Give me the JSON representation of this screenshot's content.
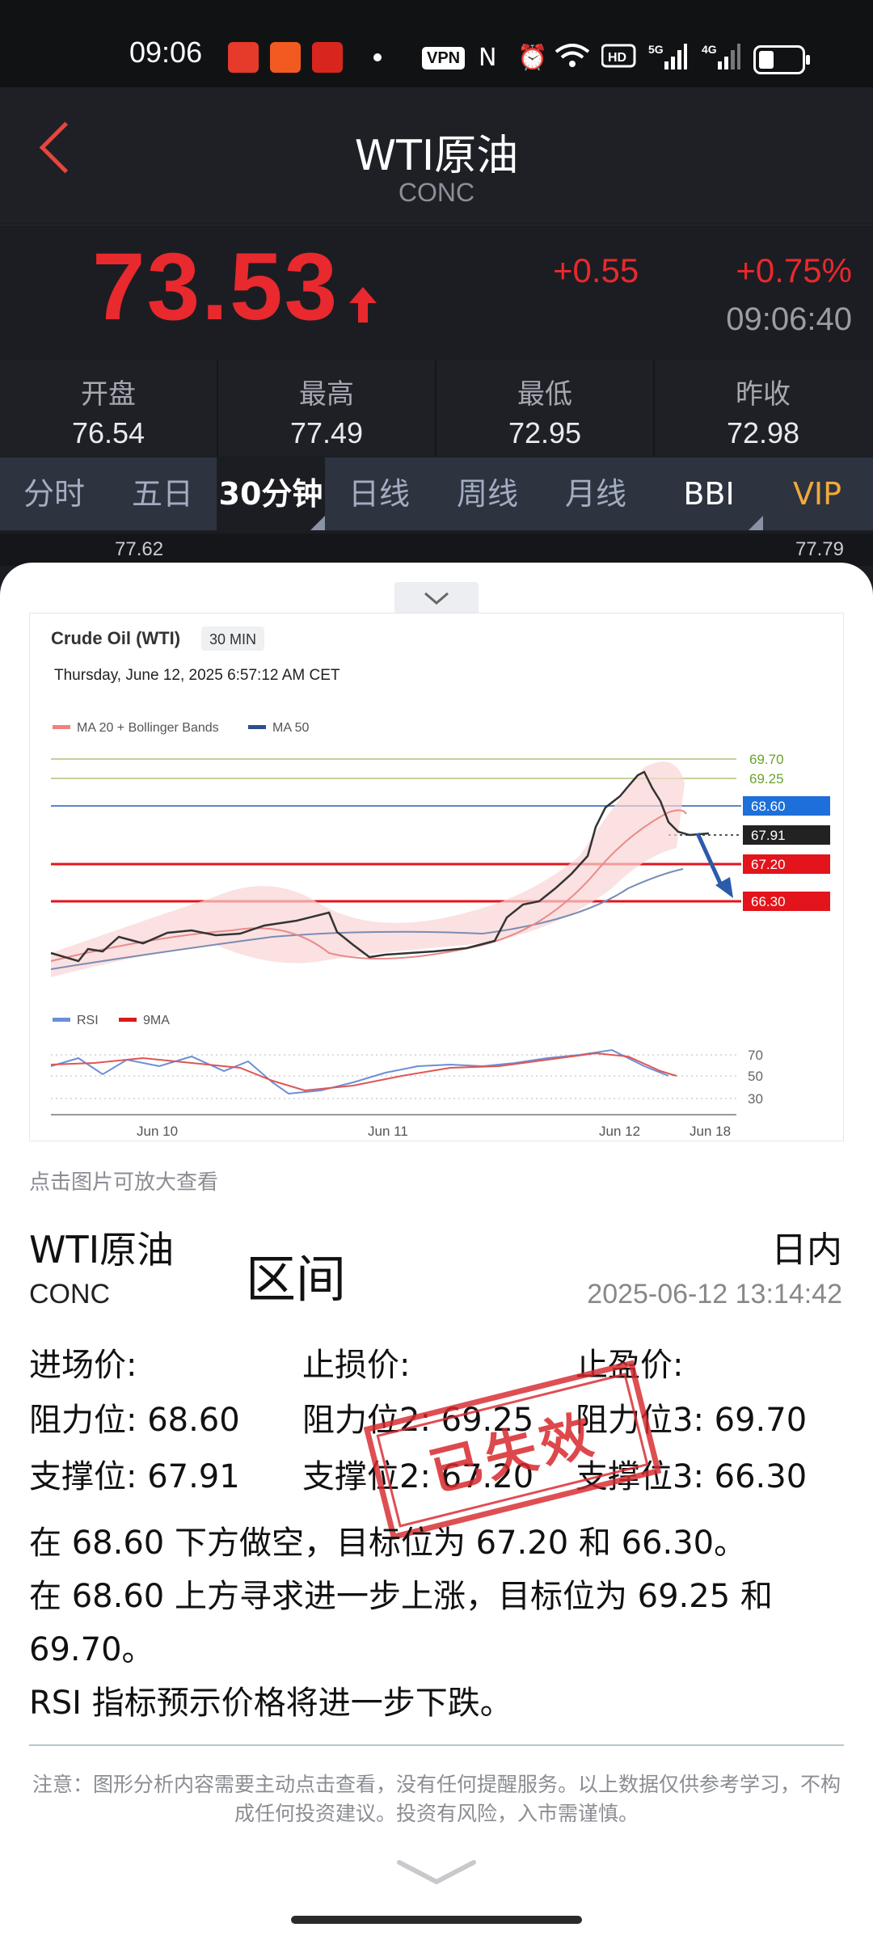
{
  "status_bar": {
    "time": "09:06",
    "vpn": "VPN"
  },
  "header": {
    "title": "WTI原油",
    "subtitle": "CONC"
  },
  "quote": {
    "price": "73.53",
    "change": "+0.55",
    "change_pct": "+0.75%",
    "time": "09:06:40"
  },
  "stats": [
    {
      "label": "开盘",
      "value": "76.54"
    },
    {
      "label": "最高",
      "value": "77.49"
    },
    {
      "label": "最低",
      "value": "72.95"
    },
    {
      "label": "昨收",
      "value": "72.98"
    }
  ],
  "tabs": [
    {
      "label": "分时"
    },
    {
      "label": "五日"
    },
    {
      "label": "30分钟"
    },
    {
      "label": "日线"
    },
    {
      "label": "周线"
    },
    {
      "label": "月线"
    },
    {
      "label": "BBI"
    },
    {
      "label": "VIP"
    }
  ],
  "peek": {
    "left_value": "77.62",
    "right_value": "77.79"
  },
  "chart_image": {
    "title": "Crude Oil (WTI)",
    "interval": "30 MIN",
    "timestamp": "Thursday, June 12, 2025 6:57:12 AM CET",
    "legend": [
      "MA 20 + Bollinger Bands",
      "MA 50"
    ],
    "levels": [
      "69.70",
      "69.25",
      "68.60",
      "67.91",
      "67.20",
      "66.30"
    ],
    "rsi_legend": [
      "RSI",
      "9MA"
    ],
    "rsi_levels": [
      "70",
      "50",
      "30"
    ],
    "x_labels": [
      "Jun 10",
      "Jun 11",
      "Jun 12",
      "Jun 18"
    ]
  },
  "hint": "点击图片可放大查看",
  "analysis": {
    "name": "WTI原油",
    "code": "CONC",
    "type": "区间",
    "period": "日内",
    "timestamp": "2025-06-12 13:14:42",
    "col_headers": [
      "进场价:",
      "止损价:",
      "止盈价:"
    ],
    "row1": [
      "阻力位:  68.60",
      "阻力位2:  69.25",
      "阻力位3:  69.70"
    ],
    "row2": [
      "支撑位:  67.91",
      "支撑位2:  67.20",
      "支撑位3:  66.30"
    ],
    "stamp": "已失效",
    "paragraph1": "在 68.60 下方做空，目标位为 67.20 和 66.30。",
    "paragraph2": "在 68.60 上方寻求进一步上涨，目标位为 69.25 和 69.70。",
    "paragraph3": "RSI 指标预示价格将进一步下跌。",
    "note": "注意：图形分析内容需要主动点击查看，没有任何提醒服务。以上数据仅供参考学习，不构成任何投资建议。投资有风险，入市需谨慎。"
  },
  "colors": {
    "up": "#e8292e",
    "vip": "#f2a93b",
    "blue_level": "#1e6fd9",
    "red_level": "#e3141b"
  }
}
